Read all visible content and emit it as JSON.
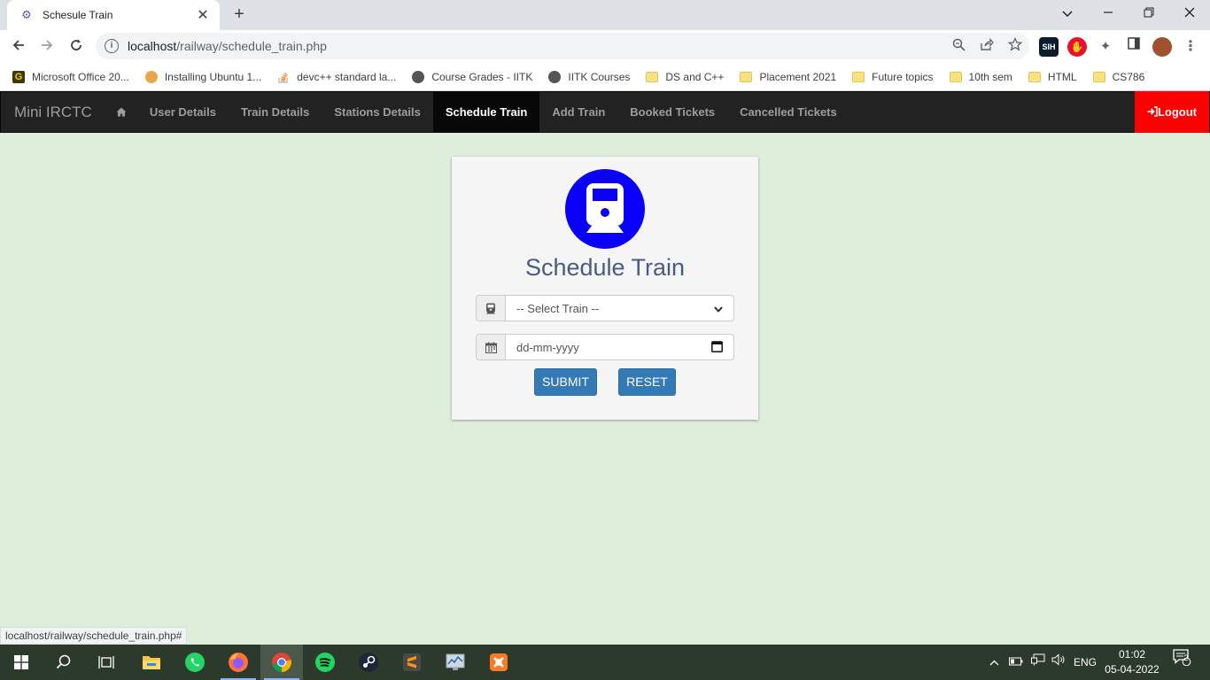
{
  "browser": {
    "tab_title": "Schesule Train",
    "tab_close": "✕",
    "new_tab": "+",
    "url_host": "localhost",
    "url_path": "/railway/schedule_train.php",
    "status_url": "localhost/railway/schedule_train.php#",
    "bookmarks": [
      {
        "label": "Microsoft Office 20...",
        "icon": "g-icon"
      },
      {
        "label": "Installing Ubuntu 1...",
        "icon": "ubuntu-icon"
      },
      {
        "label": "devc++ standard la...",
        "icon": "stackoverflow-icon"
      },
      {
        "label": "Course Grades - IITK",
        "icon": "globe-icon"
      },
      {
        "label": "IITK Courses",
        "icon": "globe-icon"
      },
      {
        "label": "DS and C++",
        "icon": "folder-icon"
      },
      {
        "label": "Placement 2021",
        "icon": "folder-icon"
      },
      {
        "label": "Future topics",
        "icon": "folder-icon"
      },
      {
        "label": "10th sem",
        "icon": "folder-icon"
      },
      {
        "label": "HTML",
        "icon": "folder-icon"
      },
      {
        "label": "CS786",
        "icon": "folder-icon"
      }
    ],
    "extension_sih_label": "SIH"
  },
  "navbar": {
    "brand": "Mini IRCTC",
    "home_icon": "home-icon",
    "items": [
      "User Details",
      "Train Details",
      "Stations Details",
      "Schedule Train",
      "Add Train",
      "Booked Tickets",
      "Cancelled Tickets"
    ],
    "active": "Schedule Train",
    "logout": "Logout"
  },
  "form": {
    "title": "Schedule Train",
    "train_select_value": "-- Select Train --",
    "date_placeholder": "dd-mm-yyyy",
    "submit_label": "SUBMIT",
    "reset_label": "RESET"
  },
  "taskbar": {
    "language": "ENG",
    "time": "01:02",
    "date": "05-04-2022",
    "notification_count": "2"
  },
  "colors": {
    "page_bg": "#dfeedb",
    "navbar_bg": "#222222",
    "logout_bg": "#ff0000",
    "button_blue": "#337ab7",
    "train_icon_blue": "#0a00f5"
  }
}
